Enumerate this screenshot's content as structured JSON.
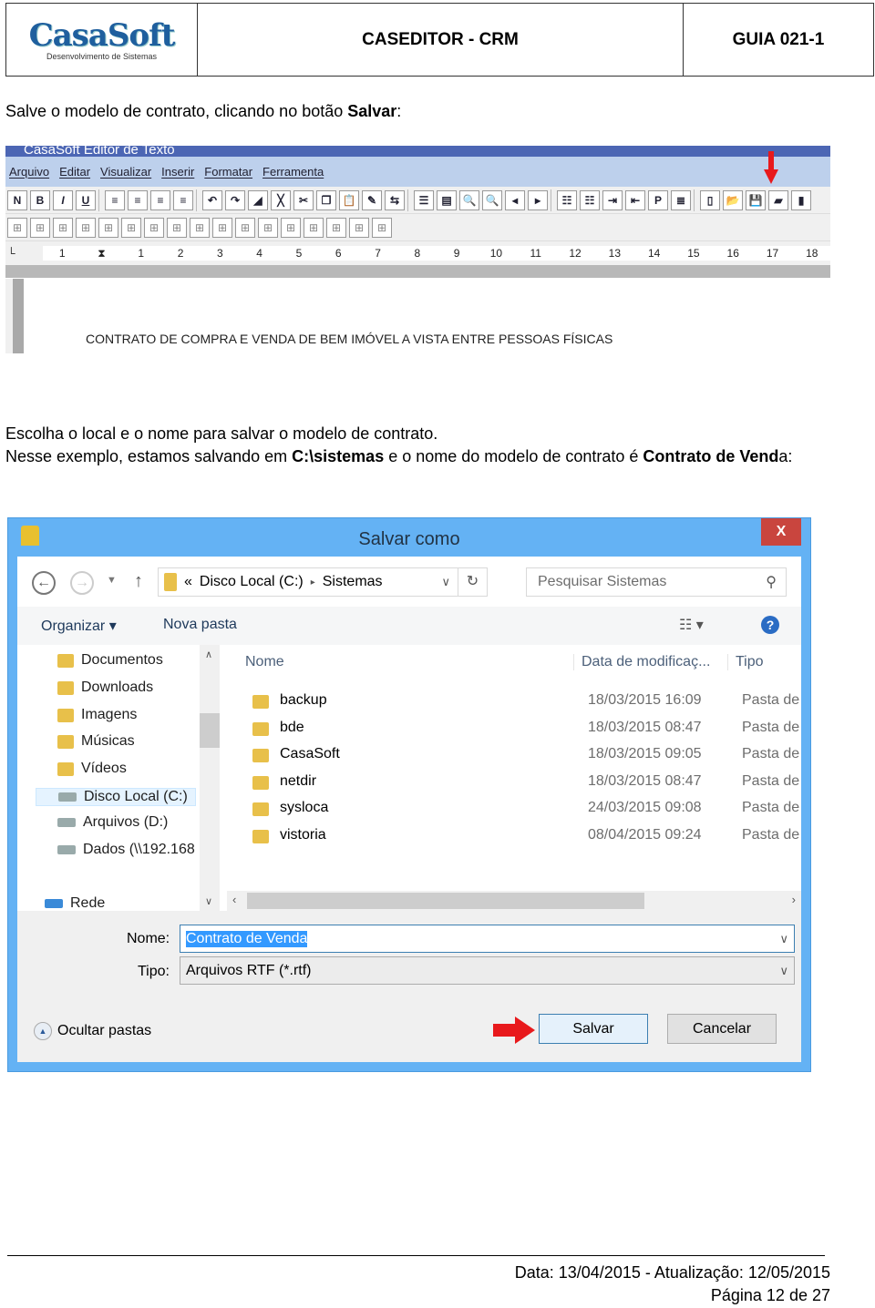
{
  "header": {
    "logo_text": "CasaSoft",
    "logo_tagline": "Desenvolvimento de Sistemas",
    "title": "CASEDITOR - CRM",
    "guide": "GUIA 021-1"
  },
  "step1": {
    "pre": "Salve o modelo de contrato, clicando no botão ",
    "bold": "Salvar",
    "post": ":"
  },
  "editor": {
    "title": "CasaSoft Editor de Texto",
    "menu": [
      "Arquivo",
      "Editar",
      "Visualizar",
      "Inserir",
      "Formatar",
      "Ferramenta"
    ],
    "toolbar1": [
      {
        "icon": "normal-icon",
        "glyph": "N"
      },
      {
        "icon": "bold-icon",
        "glyph": "B"
      },
      {
        "icon": "italic-icon",
        "glyph": "I"
      },
      {
        "icon": "underline-icon",
        "glyph": "U"
      },
      {
        "icon": "align-left-icon",
        "glyph": "≡"
      },
      {
        "icon": "align-center-icon",
        "glyph": "≡"
      },
      {
        "icon": "justify-icon",
        "glyph": "≡"
      },
      {
        "icon": "align-right-icon",
        "glyph": "≡"
      },
      {
        "icon": "undo-icon",
        "glyph": "↶"
      },
      {
        "icon": "redo-icon",
        "glyph": "↷"
      },
      {
        "icon": "highlight-icon",
        "glyph": "◢"
      },
      {
        "icon": "clear-icon",
        "glyph": "╳"
      },
      {
        "icon": "cut-icon",
        "glyph": "✂"
      },
      {
        "icon": "copy-icon",
        "glyph": "❐"
      },
      {
        "icon": "paste-icon",
        "glyph": "📋"
      },
      {
        "icon": "format-paint-icon",
        "glyph": "✎"
      },
      {
        "icon": "replace-icon",
        "glyph": "⇆"
      },
      {
        "icon": "page-icon",
        "glyph": "☰"
      },
      {
        "icon": "page-small-icon",
        "glyph": "▤"
      },
      {
        "icon": "zoom-out-icon",
        "glyph": "🔍"
      },
      {
        "icon": "zoom-in-icon",
        "glyph": "🔍"
      },
      {
        "icon": "prev-page-icon",
        "glyph": "◂"
      },
      {
        "icon": "next-page-icon",
        "glyph": "▸"
      },
      {
        "icon": "bullet-list-icon",
        "glyph": "☷"
      },
      {
        "icon": "numbered-list-icon",
        "glyph": "☷"
      },
      {
        "icon": "indent-icon",
        "glyph": "⇥"
      },
      {
        "icon": "outdent-icon",
        "glyph": "⇤"
      },
      {
        "icon": "protect-icon",
        "glyph": "P"
      },
      {
        "icon": "break-icon",
        "glyph": "≣"
      },
      {
        "icon": "new-file-icon",
        "glyph": "▯"
      },
      {
        "icon": "open-folder-icon",
        "glyph": "📂"
      },
      {
        "icon": "save-icon",
        "glyph": "💾"
      },
      {
        "icon": "export-icon",
        "glyph": "▰"
      },
      {
        "icon": "exit-icon",
        "glyph": "▮"
      }
    ],
    "toolbar2": [
      "table-icon",
      "table-insert-row-icon",
      "table-row-above-icon",
      "table-row-below-icon",
      "table-col-left-icon",
      "table-col-right-icon",
      "table-grid-icon",
      "table-merge-icon",
      "table-split-icon",
      "table-borders-icon",
      "table-inner-icon",
      "table-none-icon",
      "table-cell-icon",
      "table-cell2-icon",
      "table-cell3-icon",
      "table-cell4-icon",
      "table-cell5-icon"
    ],
    "ruler": [
      "1",
      "",
      "1",
      "2",
      "3",
      "4",
      "5",
      "6",
      "7",
      "8",
      "9",
      "10",
      "11",
      "12",
      "13",
      "14",
      "15",
      "16",
      "17",
      "18"
    ],
    "document_text": "CONTRATO DE COMPRA E VENDA DE BEM IMÓVEL A VISTA ENTRE PESSOAS FÍSICAS",
    "arrow_color": "#e8191c"
  },
  "step2": {
    "line1": "Escolha o local e o nome para salvar o modelo de contrato.",
    "pre": "Nesse exemplo, estamos salvando em ",
    "path": "C:\\sistemas",
    "mid": " e o nome do modelo de contrato é ",
    "name_bold": "Contrato de Vend",
    "name_end": "a:"
  },
  "dialog": {
    "title": "Salvar como",
    "close": "X",
    "address": {
      "prefix": "«",
      "drive": "Disco Local (C:)",
      "sep": "▸",
      "folder": "Sistemas"
    },
    "search_placeholder": "Pesquisar Sistemas",
    "organize": "Organizar ▾",
    "new_folder": "Nova pasta",
    "nav": [
      {
        "label": "Documentos",
        "icon": "folder-icon"
      },
      {
        "label": "Downloads",
        "icon": "folder-icon"
      },
      {
        "label": "Imagens",
        "icon": "folder-icon"
      },
      {
        "label": "Músicas",
        "icon": "folder-icon"
      },
      {
        "label": "Vídeos",
        "icon": "folder-icon"
      },
      {
        "label": "Disco Local (C:)",
        "icon": "drive-icon",
        "selected": true
      },
      {
        "label": "Arquivos (D:)",
        "icon": "drive-icon"
      },
      {
        "label": "Dados (\\\\192.168",
        "icon": "network-drive-icon"
      },
      {
        "label": "Rede",
        "icon": "network-icon"
      }
    ],
    "columns": [
      "Nome",
      "Data de modificaç...",
      "Tipo"
    ],
    "files": [
      {
        "name": "backup",
        "date": "18/03/2015 16:09",
        "type": "Pasta de a"
      },
      {
        "name": "bde",
        "date": "18/03/2015 08:47",
        "type": "Pasta de a"
      },
      {
        "name": "CasaSoft",
        "date": "18/03/2015 09:05",
        "type": "Pasta de a"
      },
      {
        "name": "netdir",
        "date": "18/03/2015 08:47",
        "type": "Pasta de a"
      },
      {
        "name": "sysloca",
        "date": "24/03/2015 09:08",
        "type": "Pasta de a"
      },
      {
        "name": "vistoria",
        "date": "08/04/2015 09:24",
        "type": "Pasta de a"
      }
    ],
    "name_label": "Nome:",
    "name_value": "Contrato de Venda",
    "type_label": "Tipo:",
    "type_value": "Arquivos RTF (*.rtf)",
    "hide_folders": "Ocultar pastas",
    "save": "Salvar",
    "cancel": "Cancelar",
    "accent": "#64b2f4"
  },
  "footer": {
    "dates": "Data: 13/04/2015  -  Atualização: 12/05/2015",
    "page": "Página 12 de 27"
  }
}
